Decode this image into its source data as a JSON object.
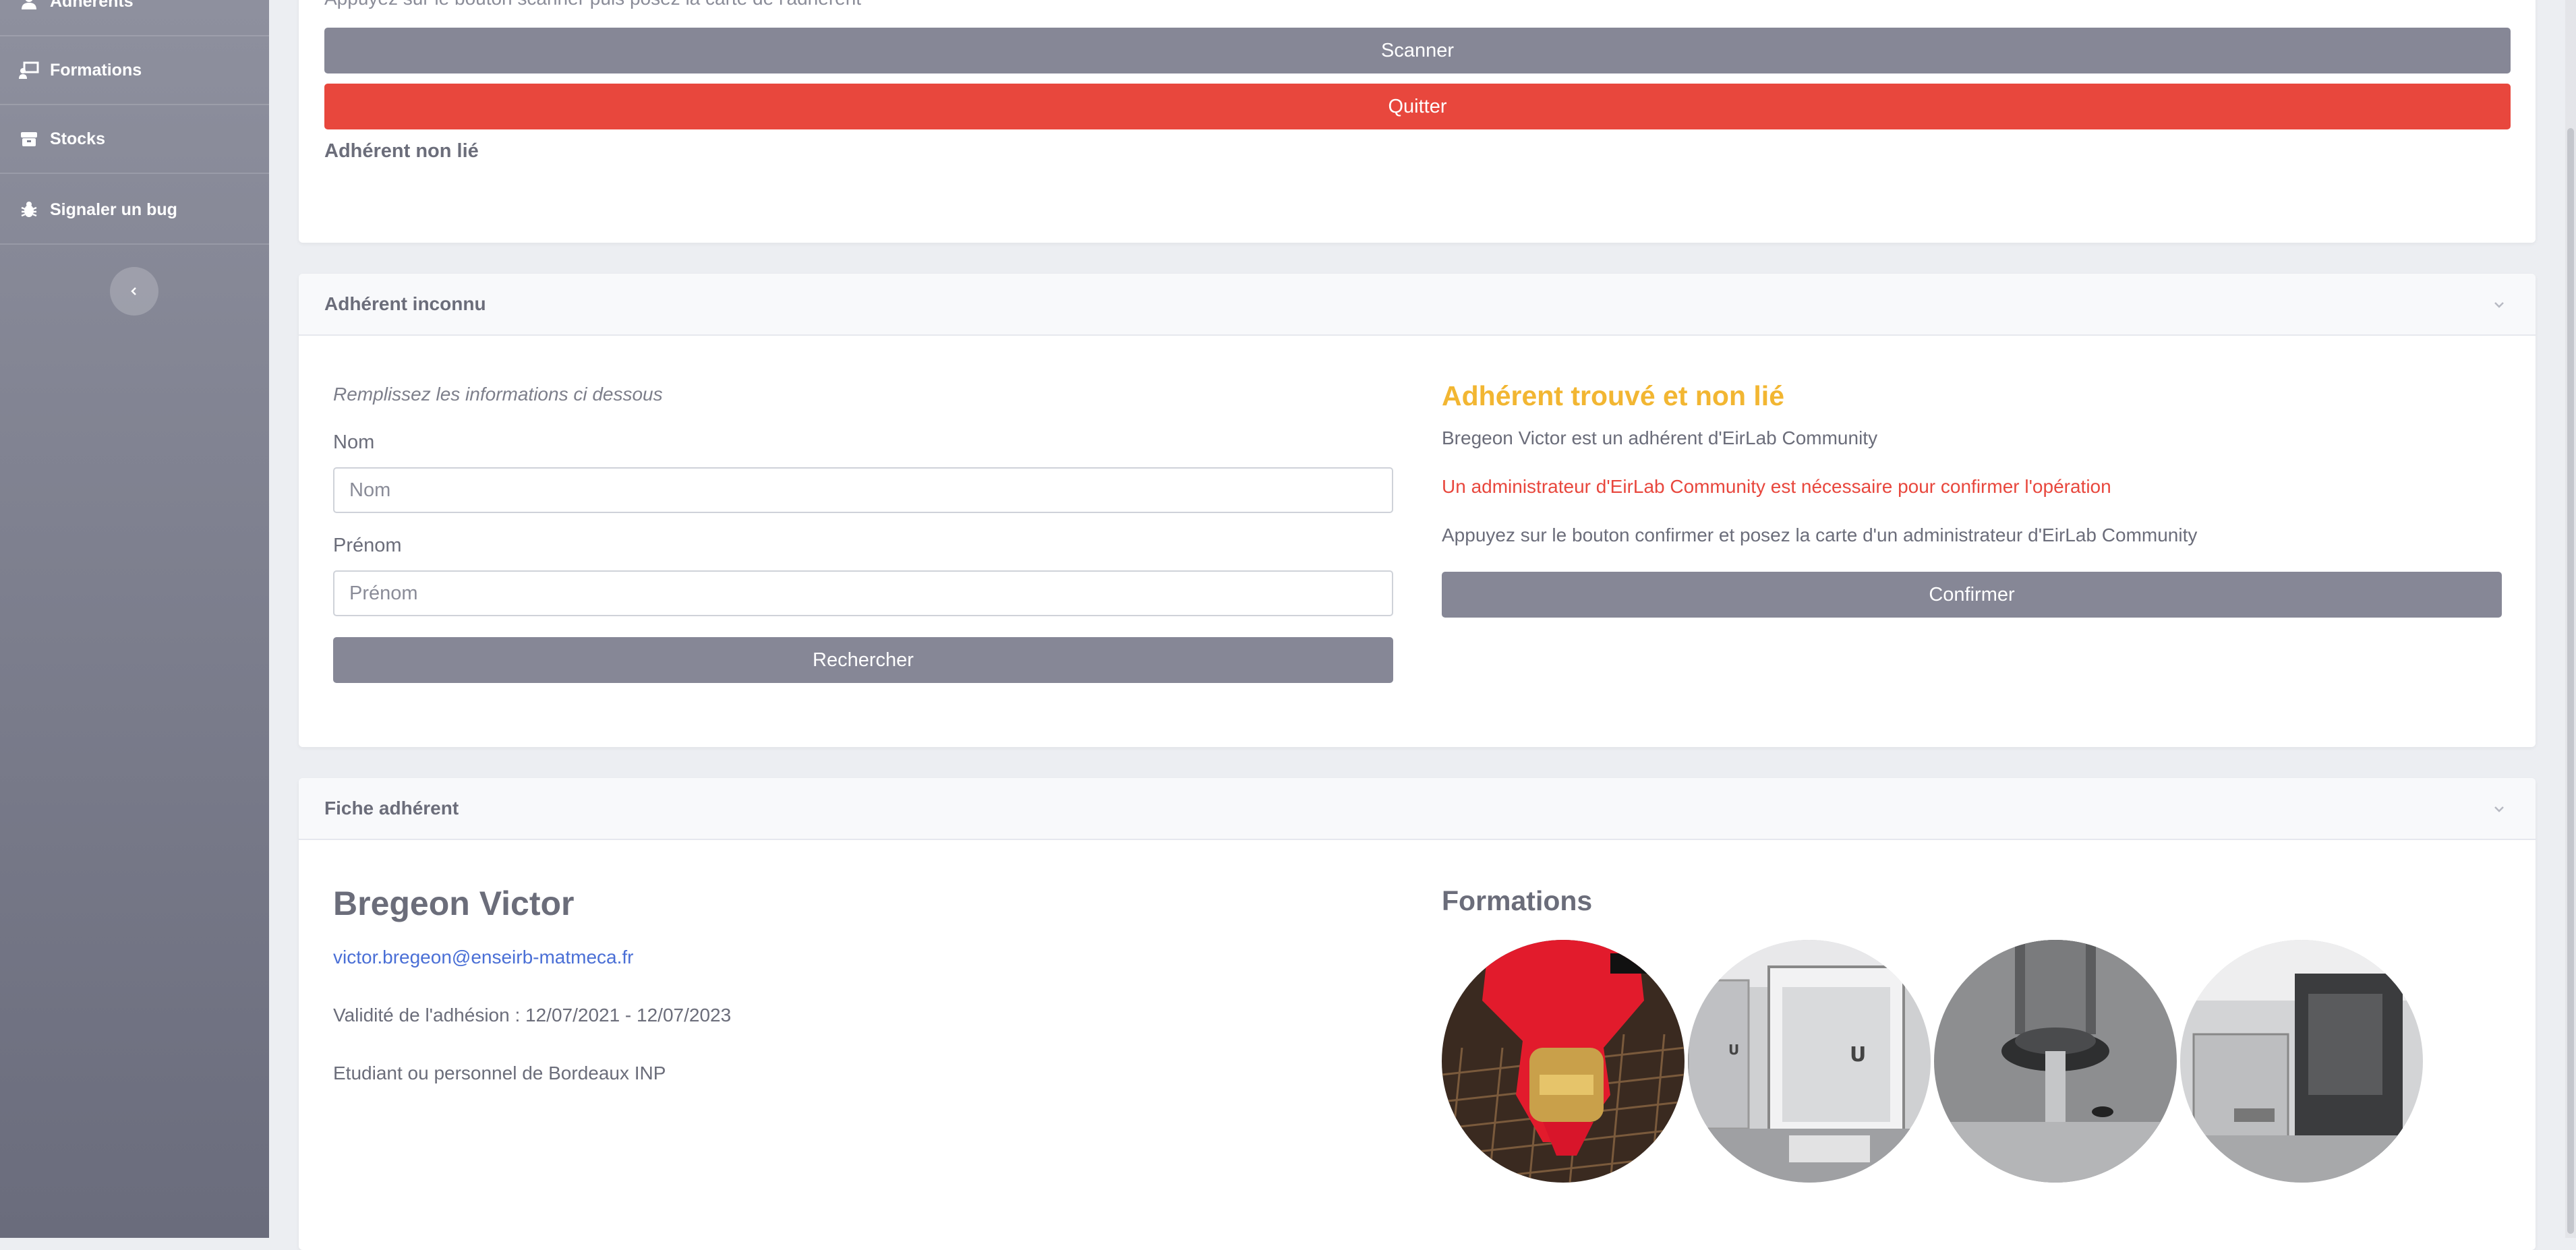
{
  "sidebar": {
    "items": [
      {
        "label": "Adhérents",
        "icon": "user-icon"
      },
      {
        "label": "Formations",
        "icon": "chalkboard-teacher-icon"
      },
      {
        "label": "Stocks",
        "icon": "box-icon"
      },
      {
        "label": "Signaler un bug",
        "icon": "bug-icon"
      }
    ],
    "collapse_icon": "chevron-left-icon"
  },
  "scan_card": {
    "truncated_text": "Appuyez sur le bouton scanner puis posez la carte de l'adhérent",
    "scan_button": "Scanner",
    "quit_button": "Quitter",
    "status": "Adhérent non lié"
  },
  "unknown_card": {
    "title": "Adhérent inconnu",
    "hint": "Remplissez les informations ci dessous",
    "nom_label": "Nom",
    "nom_placeholder": "Nom",
    "nom_value": "",
    "prenom_label": "Prénom",
    "prenom_placeholder": "Prénom",
    "prenom_value": "",
    "search_button": "Rechercher",
    "found_title": "Adhérent trouvé et non lié",
    "found_text": "Bregeon Victor est un adhérent d'EirLab Community",
    "admin_required": "Un administrateur d'EirLab Community est nécessaire pour confirmer l'opération",
    "instruction": "Appuyez sur le bouton confirmer et posez la carte d'un administrateur d'EirLab Community",
    "confirm_button": "Confirmer"
  },
  "member_card": {
    "title": "Fiche adhérent",
    "name": "Bregeon Victor",
    "email": "victor.bregeon@enseirb-matmeca.fr",
    "validity": "Validité de l'adhésion : 12/07/2021 - 12/07/2023",
    "status": "Etudiant ou personnel de Bordeaux INP",
    "formations_title": "Formations",
    "formations": [
      "laser-cutter-photo",
      "3d-printer-photo",
      "cnc-mill-photo",
      "machine-photo"
    ]
  },
  "colors": {
    "accent_warning": "#f2b632",
    "danger": "#e8473d",
    "button_grey": "#868796",
    "link": "#4a6fd6"
  }
}
